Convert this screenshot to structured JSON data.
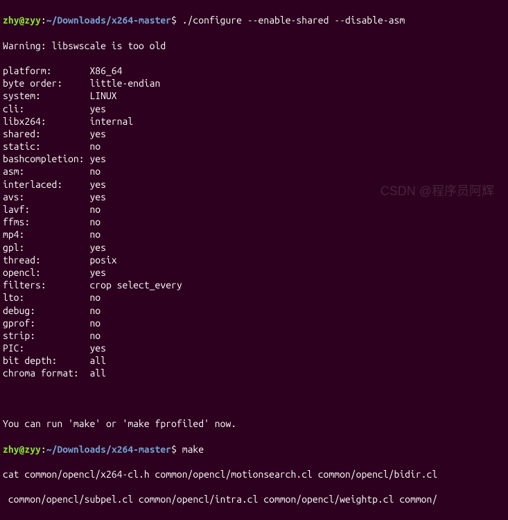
{
  "prompt1": {
    "user": "zhy@zyy",
    "sep": ":",
    "path": "~/Downloads/x264-master",
    "dollar": "$ ",
    "command": "./configure --enable-shared --disable-asm"
  },
  "warning": "Warning: libswscale is too old",
  "config_rows": [
    {
      "key": "platform:",
      "val": "X86_64"
    },
    {
      "key": "byte order:",
      "val": "little-endian"
    },
    {
      "key": "system:",
      "val": "LINUX"
    },
    {
      "key": "cli:",
      "val": "yes"
    },
    {
      "key": "libx264:",
      "val": "internal"
    },
    {
      "key": "shared:",
      "val": "yes"
    },
    {
      "key": "static:",
      "val": "no"
    },
    {
      "key": "bashcompletion:",
      "val": "yes"
    },
    {
      "key": "asm:",
      "val": "no"
    },
    {
      "key": "interlaced:",
      "val": "yes"
    },
    {
      "key": "avs:",
      "val": "yes"
    },
    {
      "key": "lavf:",
      "val": "no"
    },
    {
      "key": "ffms:",
      "val": "no"
    },
    {
      "key": "mp4:",
      "val": "no"
    },
    {
      "key": "gpl:",
      "val": "yes"
    },
    {
      "key": "thread:",
      "val": "posix"
    },
    {
      "key": "opencl:",
      "val": "yes"
    },
    {
      "key": "filters:",
      "val": "crop select_every"
    },
    {
      "key": "lto:",
      "val": "no"
    },
    {
      "key": "debug:",
      "val": "no"
    },
    {
      "key": "gprof:",
      "val": "no"
    },
    {
      "key": "strip:",
      "val": "no"
    },
    {
      "key": "PIC:",
      "val": "yes"
    },
    {
      "key": "bit depth:",
      "val": "all"
    },
    {
      "key": "chroma format:",
      "val": "all"
    }
  ],
  "hint": "You can run 'make' or 'make fprofiled' now.",
  "prompt2": {
    "user": "zhy@zyy",
    "sep": ":",
    "path": "~/Downloads/x264-master",
    "dollar": "$ ",
    "command": "make"
  },
  "make_out1": "cat common/opencl/x264-cl.h common/opencl/motionsearch.cl common/opencl/bidir.cl",
  "make_out2": " common/opencl/subpel.cl common/opencl/intra.cl common/opencl/weightp.cl common/",
  "watermark": "CSDN @程序员阿辉"
}
